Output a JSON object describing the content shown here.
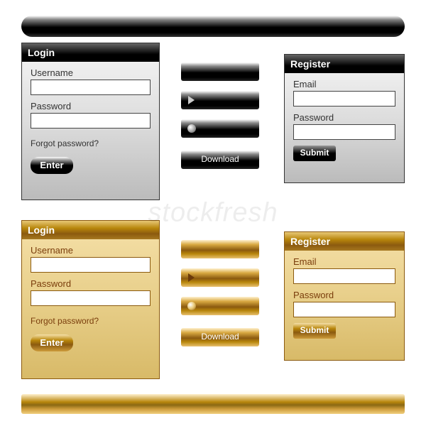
{
  "watermark": "stockfresh",
  "themes": {
    "black": {
      "login": {
        "title": "Login",
        "username_label": "Username",
        "password_label": "Password",
        "forgot_link": "Forgot password?",
        "enter_btn": "Enter"
      },
      "register": {
        "title": "Register",
        "email_label": "Email",
        "password_label": "Password",
        "submit_btn": "Submit"
      },
      "buttons": {
        "download": "Download"
      }
    },
    "gold": {
      "login": {
        "title": "Login",
        "username_label": "Username",
        "password_label": "Password",
        "forgot_link": "Forgot password?",
        "enter_btn": "Enter"
      },
      "register": {
        "title": "Register",
        "email_label": "Email",
        "password_label": "Password",
        "submit_btn": "Submit"
      },
      "buttons": {
        "download": "Download"
      }
    }
  }
}
